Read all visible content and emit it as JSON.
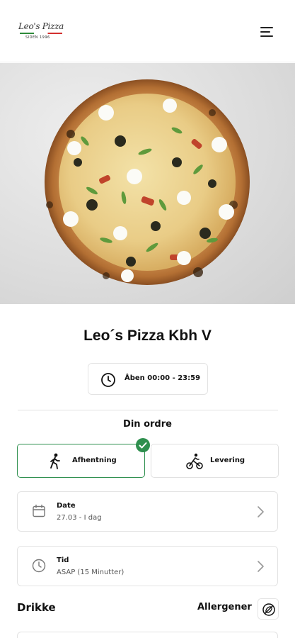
{
  "header": {
    "logo": {
      "script_text": "Leo's Pizza",
      "since_text": "SIDEN 1996"
    },
    "menu_icon": "hamburger-icon"
  },
  "hero": {
    "image": "pizza-photo"
  },
  "store": {
    "name": "Leo´s Pizza Kbh V",
    "hours_icon": "clock-icon",
    "hours": "Åben 00:00 - 23:59"
  },
  "order": {
    "heading": "Din ordre",
    "modes": [
      {
        "label": "Afhentning",
        "icon": "walking-person-icon",
        "selected": true
      },
      {
        "label": "Levering",
        "icon": "cyclist-icon",
        "selected": false
      }
    ],
    "selected_color": "#2e8f4e",
    "date": {
      "label": "Date",
      "value": "27.03 - I dag",
      "icon": "calendar-icon"
    },
    "time": {
      "label": "Tid",
      "value": "ASAP (15 Minutter)",
      "icon": "clock-icon"
    }
  },
  "menu": {
    "category": "Drikke",
    "allergens_label": "Allergener",
    "allergens_icon": "no-allergen-icon"
  }
}
